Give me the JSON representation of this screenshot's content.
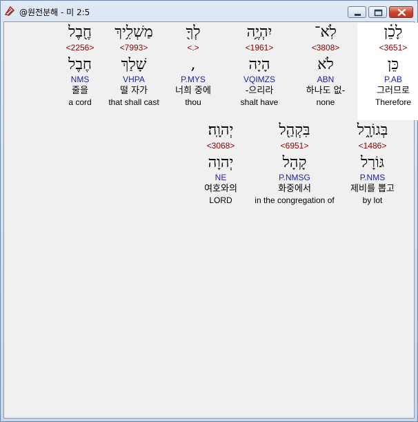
{
  "window": {
    "title": "@원전분해 - 미 2:5",
    "icons": {
      "app": "bible-app-icon",
      "minimize": "minimize-icon",
      "maximize": "maximize-icon",
      "close": "close-icon"
    },
    "colors": {
      "strong_number": "#8b0000",
      "morphology": "#1c1ca8",
      "close_button": "#c5452f"
    }
  },
  "verse": {
    "line1": [
      {
        "hebrew": "לָכֵ֗ן",
        "strong": "<3651>",
        "lemma": "כֵּן",
        "morph": "P.AB",
        "korean": "그러므로",
        "english": "Therefore",
        "selected": true
      },
      {
        "hebrew": "לֹֽא־",
        "strong": "<3808>",
        "lemma": "לֹא",
        "morph": "ABN",
        "korean": "하나도 없-",
        "english": "none",
        "selected": false
      },
      {
        "hebrew": "יִהְיֶ֥ה",
        "strong": "<1961>",
        "lemma": "הָיָה",
        "morph": "VQIMZS",
        "korean": "-으리라",
        "english": "shalt have",
        "selected": false
      },
      {
        "hebrew": "לְךָ֖",
        "strong": "<.>",
        "lemma": ",",
        "morph": "P.MYS",
        "korean": "너희 중에",
        "english": "thou",
        "selected": false
      },
      {
        "hebrew": "מַשְׁלִ֥יךְ",
        "strong": "<7993>",
        "lemma": "שָׁלַךְ",
        "morph": "VHPA",
        "korean": "떨 자가",
        "english": "that shall cast",
        "selected": false
      },
      {
        "hebrew": "חֶ֖בֶל",
        "strong": "<2256>",
        "lemma": "חֶבֶל",
        "morph": "NMS",
        "korean": "줄을",
        "english": "a cord",
        "selected": false
      }
    ],
    "line2": [
      {
        "hebrew": "בְּגוֹרָ֑ל",
        "strong": "<1486>",
        "lemma": "גּוֹרָל",
        "morph": "P.NMS",
        "korean": "제비를 뽑고",
        "english": "by lot",
        "selected": false
      },
      {
        "hebrew": "בִּקְהַ֖ל",
        "strong": "<6951>",
        "lemma": "קָהָל",
        "morph": "P.NMSG",
        "korean": "화중에서",
        "english": "in the congregation of",
        "selected": false
      },
      {
        "hebrew": "יְהוָֽה׃",
        "strong": "<3068>",
        "lemma": "יְהוָה",
        "morph": "NE",
        "korean": "여호와의",
        "english": "LORD",
        "selected": false
      }
    ]
  }
}
